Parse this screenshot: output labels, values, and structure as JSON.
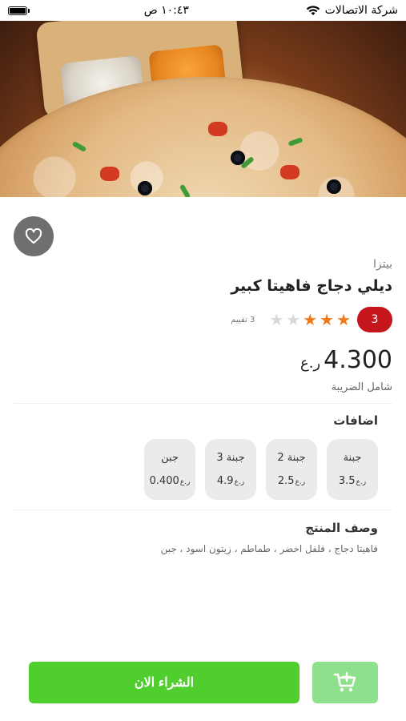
{
  "status_bar": {
    "carrier": "شركة الاتصالات",
    "time": "١٠:٤٣ ص",
    "icons": [
      "wifi-icon",
      "battery-icon"
    ]
  },
  "product": {
    "category": "بيتزا",
    "name": "ديلي دجاج فاهيتا كبير",
    "rating_badge": "3",
    "stars_filled": 3,
    "stars_total": 5,
    "rating_count_label": "3 تقييم",
    "price": "4.300",
    "currency": "ر.ع",
    "tax_note": "شامل الضريبة"
  },
  "addons": {
    "title": "اضافات",
    "items": [
      {
        "name": "جبنة",
        "price": "3.5",
        "currency": "ر.ع"
      },
      {
        "name": "جبنة 2",
        "price": "2.5",
        "currency": "ر.ع"
      },
      {
        "name": "جبنة 3",
        "price": "4.9",
        "currency": "ر.ع"
      },
      {
        "name": "جبن",
        "price": "0.400",
        "currency": "ر.ع"
      }
    ]
  },
  "description": {
    "title": "وصف المنتج",
    "text": "فاهيتا دجاج ، فلفل اخضر ، طماطم ، زيتون اسود ، جبن"
  },
  "actions": {
    "buy_label": "الشراء الان"
  },
  "colors": {
    "buy_button": "#4fce2e",
    "cart_button": "#8fe08d",
    "rating_badge": "#c4161c",
    "star_on": "#f07a1a"
  }
}
